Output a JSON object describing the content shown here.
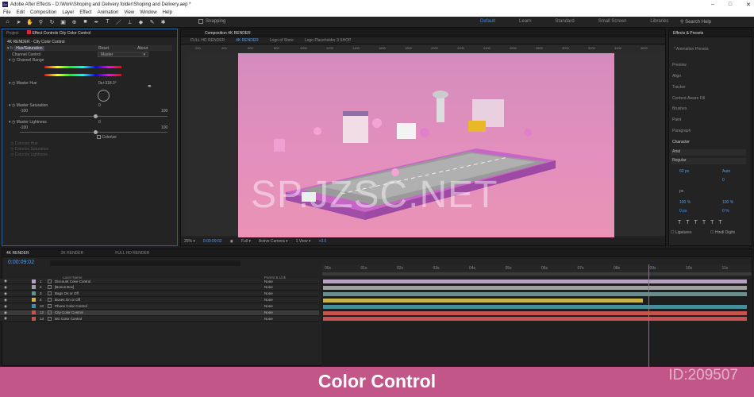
{
  "app": {
    "title": "Adobe After Effects - D:\\Work\\Shoping and Delivery folder\\Shoping and Delivery.aep *",
    "icon": "Ae"
  },
  "menu": [
    "File",
    "Edit",
    "Composition",
    "Layer",
    "Effect",
    "Animation",
    "View",
    "Window",
    "Help"
  ],
  "toolbar": {
    "snapping": "Snapping",
    "workspaces": [
      "Default",
      "Learn",
      "Standard",
      "Small Screen",
      "Libraries"
    ],
    "search": "Search Help"
  },
  "window_controls": [
    "–",
    "□",
    "✕"
  ],
  "left_panel": {
    "tabs": [
      "Project",
      "Effect Controls City Color Control"
    ],
    "subtitle": "4K RENDER - City Color Control",
    "effect_name": "Hue/Saturation",
    "reset": "Reset",
    "about": "About",
    "channel_control_label": "Channel Control",
    "channel_control_value": "Master",
    "channel_range": "Channel Range",
    "master_hue": "Master Hue",
    "master_hue_value": "0x+318.0°",
    "master_saturation": "Master Saturation",
    "master_saturation_value": "0",
    "master_lightness": "Master Lightness",
    "master_lightness_value": "0",
    "min": "-100",
    "max": "100",
    "colorize": "Colorize",
    "colorize_hue": "Colorize Hue",
    "colorize_saturation": "Colorize Saturation",
    "colorize_lightness": "Colorize Lightness"
  },
  "comp_panel": {
    "tab": "Composition 4K RENDER",
    "subtabs": [
      "FULL HD RENDER",
      "4K RENDER",
      "Logo of Store",
      "Logo Placeholder 3 SHOP"
    ],
    "zoom": "25%",
    "timecode": "0:00:09:02",
    "resolution": "Full",
    "camera": "Active Camera",
    "view": "1 View",
    "offset": "+0.0",
    "ruler_ticks": [
      "200",
      "400",
      "600",
      "800",
      "1000",
      "1200",
      "1400",
      "1600",
      "1800",
      "2000",
      "2200",
      "2400",
      "2600",
      "2800",
      "3000",
      "3200",
      "3400",
      "3600"
    ]
  },
  "right_panel": {
    "tab": "Effects & Presets",
    "preset": "* Animation Presets",
    "items": [
      "Preview",
      "Align",
      "Tracker",
      "Content-Aware Fill",
      "Brushes",
      "Paint",
      "Paragraph"
    ],
    "character": "Character",
    "font": "Arial",
    "style": "Regular",
    "size": "60 px",
    "leading": "Auto",
    "tracking": "0",
    "stroke": "px",
    "vscale": "100 %",
    "hscale": "100 %",
    "baseline": "0 px",
    "tsume": "0 %",
    "ligatures": "Ligatures",
    "hindi": "Hindi Digits"
  },
  "timeline": {
    "tabs": [
      "4K RENDER",
      "2K RENDER",
      "FULL HD RENDER"
    ],
    "timecode": "0:00:09:02",
    "columns": [
      "Layer Name",
      "Parent & Link"
    ],
    "ticks": [
      "00s",
      "01s",
      "02s",
      "03s",
      "04s",
      "05s",
      "06s",
      "07s",
      "08s",
      "09s",
      "10s",
      "11s"
    ],
    "layers": [
      {
        "num": "1",
        "name": "Discount Color Control",
        "parent": "None",
        "color": "#b7a2c4"
      },
      {
        "num": "2",
        "name": "[Bonus Box]",
        "parent": "None",
        "color": "#a0a0a0"
      },
      {
        "num": "3",
        "name": "Bags On or Off",
        "parent": "None",
        "color": "#6b8e8e"
      },
      {
        "num": "4",
        "name": "Boxes On or Off",
        "parent": "None",
        "color": "#c8b44a"
      },
      {
        "num": "10",
        "name": "Phone Color Control",
        "parent": "None",
        "color": "#4a8a9a"
      },
      {
        "num": "12",
        "name": "City Color Control",
        "parent": "None",
        "color": "#c2564a"
      },
      {
        "num": "13",
        "name": "BG Color Control",
        "parent": "None",
        "color": "#c85050"
      }
    ]
  },
  "overlay": {
    "watermark": "SP.JZSC.NET",
    "title": "Color Control",
    "id": "ID:209507"
  }
}
